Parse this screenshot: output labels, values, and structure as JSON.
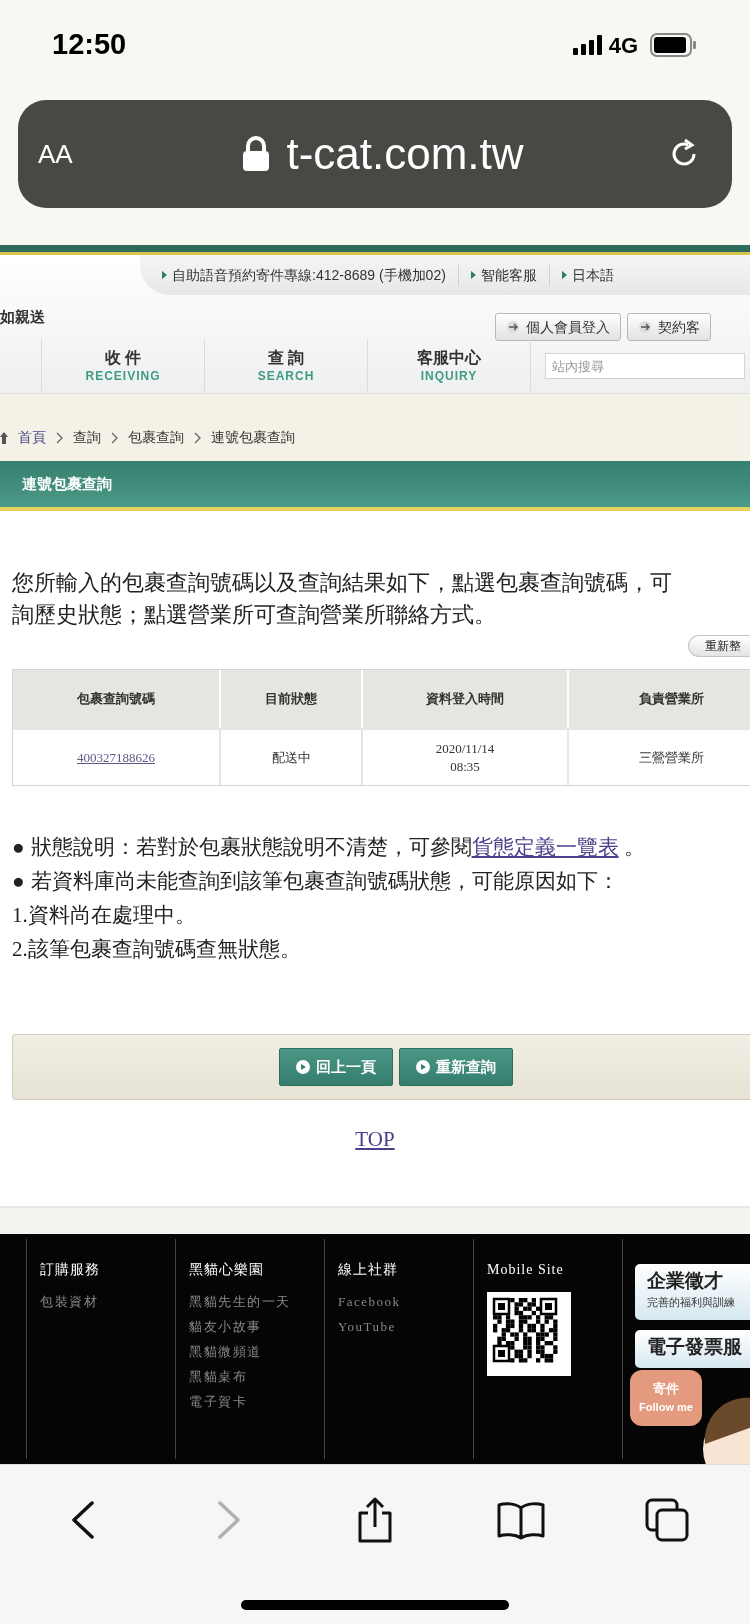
{
  "status_bar": {
    "time": "12:50",
    "network": "4G"
  },
  "browser": {
    "text_size_button": "AA",
    "url": "t-cat.com.tw"
  },
  "site_header": {
    "top_links": [
      "自助語音預約寄件專線:412-8689 (手機加02)",
      "智能客服",
      "日本語"
    ],
    "tagline": "如親送",
    "login_buttons": [
      "個人會員登入",
      "契約客"
    ],
    "nav": [
      {
        "label": "收 件",
        "sub": "RECEIVING"
      },
      {
        "label": "查 詢",
        "sub": "SEARCH"
      },
      {
        "label": "客服中心",
        "sub": "INQUIRY"
      }
    ],
    "search": {
      "placeholder": "站內搜尋"
    }
  },
  "breadcrumb": [
    "首頁",
    "查詢",
    "包裹查詢",
    "連號包裹查詢"
  ],
  "page_title": "連號包裹查詢",
  "intro": [
    "您所輸入的包裹查詢號碼以及查詢結果如下，點選包裹查詢號碼，可",
    "詢歷史狀態；點選營業所可查詢營業所聯絡方式。"
  ],
  "refresh_button": "重新整",
  "table": {
    "columns": [
      "包裹查詢號碼",
      "目前狀態",
      "資料登入時間",
      "負責營業所"
    ],
    "rows": [
      {
        "cells": [
          "400327188626",
          "配送中",
          "2020/11/14\n08:35",
          "三鶯營業所"
        ]
      }
    ]
  },
  "notes": [
    {
      "kind": "bullet",
      "marker": "●",
      "text": "狀態說明：若對於包裹狀態說明不清楚，可參閱",
      "link": "貨態定義一覽表",
      "tail": " 。"
    },
    {
      "kind": "bullet",
      "marker": "●",
      "text": "若資料庫尚未能查詢到該筆包裹查詢號碼狀態，可能原因如下："
    },
    {
      "kind": "plain",
      "text": "1.資料尚在處理中。"
    },
    {
      "kind": "plain",
      "text": "2.該筆包裹查詢號碼查無狀態。"
    }
  ],
  "action_buttons": [
    "回上一頁",
    "重新查詢"
  ],
  "top_link": "TOP",
  "footer": {
    "columns": [
      {
        "kind": "links",
        "title": "訂購服務",
        "links": [
          "包裝資材"
        ]
      },
      {
        "kind": "links",
        "title": "黑貓心樂園",
        "links": [
          "黑貓先生的一天",
          "貓友小故事",
          "黑貓微頻道",
          "黑貓桌布",
          "電子賀卡"
        ]
      },
      {
        "kind": "links",
        "title": "線上社群",
        "links": [
          "Facebook",
          "YouTube"
        ]
      },
      {
        "kind": "qr",
        "title": "Mobile Site"
      }
    ],
    "banners": [
      {
        "title": "企業徵才",
        "subtitle": "完善的福利與訓練"
      },
      {
        "title": "電子發票服"
      }
    ],
    "mascot_bubble": [
      "寄件",
      "Follow me"
    ]
  },
  "toolbar": [
    {
      "kind": "back",
      "disabled": false
    },
    {
      "kind": "forward",
      "disabled": true
    },
    {
      "kind": "share",
      "disabled": false
    },
    {
      "kind": "bookmarks",
      "disabled": false
    },
    {
      "kind": "tabs",
      "disabled": false
    }
  ]
}
